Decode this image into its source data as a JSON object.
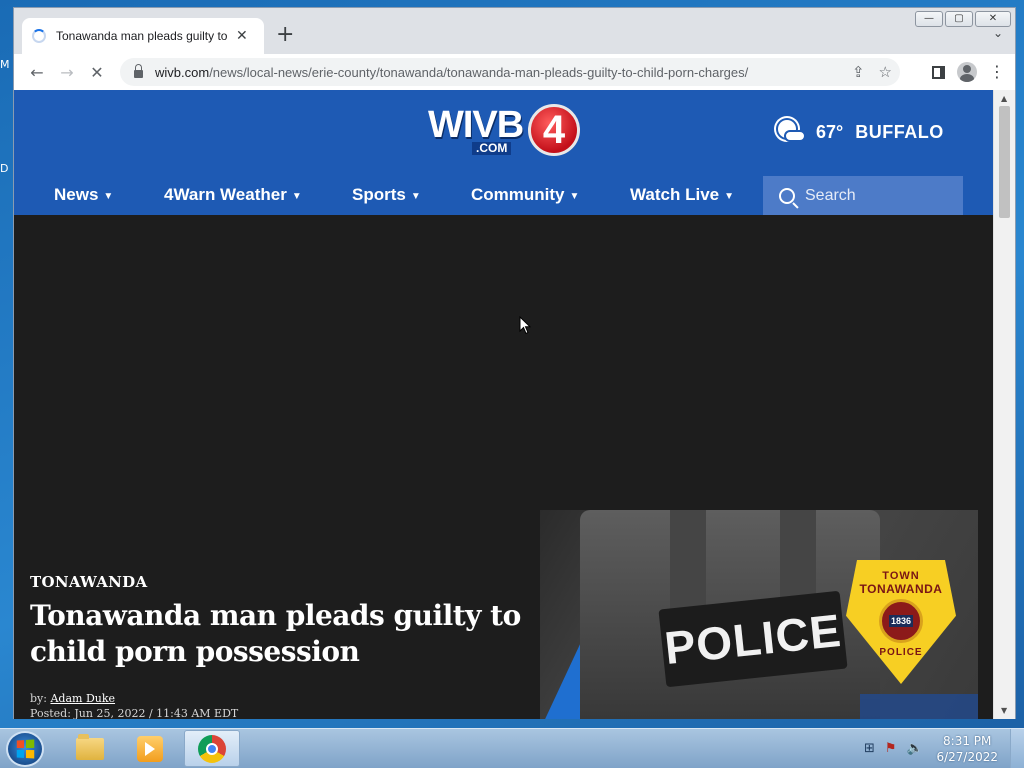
{
  "desktop": {
    "left_letters": [
      "M",
      "D"
    ]
  },
  "window_controls": {
    "minimize": "—",
    "maximize": "▢",
    "close": "✕"
  },
  "browser": {
    "tab": {
      "title": "Tonawanda man pleads guilty to child porn charges",
      "close": "✕"
    },
    "new_tab": "+",
    "tab_list": "⌄",
    "nav": {
      "back": "←",
      "forward": "→",
      "reload": "✕"
    },
    "omnibox": {
      "domain": "wivb.com",
      "path": "/news/local-news/erie-county/tonawanda/tonawanda-man-pleads-guilty-to-child-porn-charges/",
      "share": "⇪",
      "bookmark": "☆"
    },
    "menu": "⋮"
  },
  "site": {
    "logo": {
      "wordmark": "WIVB",
      "com": ".COM",
      "channel": "4"
    },
    "weather": {
      "temperature": "67°",
      "city": "BUFFALO"
    },
    "nav": [
      {
        "label": "News",
        "caret": "▼"
      },
      {
        "label": "4Warn Weather",
        "caret": "▼"
      },
      {
        "label": "Sports",
        "caret": "▼"
      },
      {
        "label": "Community",
        "caret": "▼"
      },
      {
        "label": "Watch Live",
        "caret": "▼"
      }
    ],
    "search": {
      "placeholder": "Search"
    }
  },
  "article": {
    "category": "TONAWANDA",
    "headline": "Tonawanda man pleads guilty to child porn possession",
    "byline_prefix": "by:",
    "author": "Adam Duke",
    "posted": "Posted: Jun 25, 2022 / 11:43 AM EDT",
    "image": {
      "vest_text": "POLICE",
      "badge_town": "TOWN",
      "badge_name": "TONAWANDA",
      "badge_year": "1836",
      "badge_police": "POLICE"
    }
  },
  "taskbar": {
    "time": "8:31 PM",
    "date": "6/27/2022"
  },
  "colors": {
    "site_blue": "#1e5ab4",
    "search_bg": "#4d7bc8",
    "page_bg": "#1d1d1d",
    "logo_red": "#c3101a",
    "badge_gold": "#f7cf23"
  }
}
